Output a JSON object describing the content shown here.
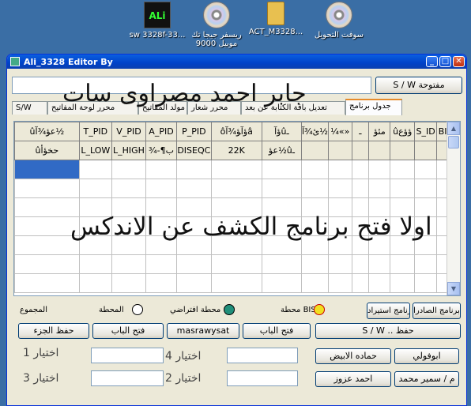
{
  "desktop": {
    "icons": [
      {
        "label": "sw 3328f-33...",
        "kind": "ali-icon",
        "text": "ALi"
      },
      {
        "label": "ريسفر جيجا تك موبيل 9000",
        "kind": "cd-icon"
      },
      {
        "label": "ACT_M3328...",
        "kind": "folder-icon"
      },
      {
        "label": "سوفت التحويل",
        "kind": "cd-icon"
      }
    ]
  },
  "window": {
    "title": "Ali_3328 Editor By",
    "controls": {
      "minimize": "_",
      "maximize": "□",
      "close": "✕"
    }
  },
  "top": {
    "textbox_value": "",
    "key_button": "S / W مفتوحة"
  },
  "overlay": {
    "name": "جابر احمد مصراوى سات",
    "instruction": "اولا فتح برنامج الكشف عن الاندكس"
  },
  "tabs": [
    {
      "label": "جدول برنامج",
      "active": true
    },
    {
      "label": "تعديل باقة الكتابة عن بعد",
      "active": false
    },
    {
      "label": "محرر شعار",
      "active": false
    },
    {
      "label": "مولد المفاتيح",
      "active": false
    },
    {
      "label": "محرر لوحة المفاتيح",
      "active": false
    },
    {
      "label": "S/W",
      "active": false
    }
  ],
  "grid": {
    "headers": [
      "ûعؤ¾آ½",
      "T_PID",
      "V_PID",
      "A_PID",
      "P_PID",
      "ôآ‍ؤ¾آ‎ؤâ",
      "ؤآûـ",
      "ئ¾آ½",
      "¼«»",
      "ـ",
      "مئؤ",
      "ûؤؤع",
      "S_ID",
      "BISS"
    ],
    "row2": [
      "ûحخؤأ",
      "L_LOW",
      "L_HIGH",
      "¾-¶ب",
      "DISEQC",
      "22K",
      "عؤ½ûـ",
      "",
      "",
      "",
      "",
      "",
      "",
      ""
    ]
  },
  "status": {
    "items": [
      "المجموع",
      "المحطة",
      "محطة افتراضي",
      "محطة BISS"
    ],
    "colors": {
      "circle_white": "#ffffff",
      "circle_green": "#1f8f7a",
      "circle_yellow": "#f0e020"
    }
  },
  "buttons": {
    "save_part": "حفظ الجزء",
    "open_door1": "فتح الباب",
    "masrawysat": "masrawysat",
    "open_door2": "فتح الباب",
    "save_sw": "S / W .. حفظ",
    "import_prog": "برنامج استيراد",
    "export_prog": "برنامج الصادرا",
    "ibofooli": "ابوفولي",
    "hamada": "حماده الابيض",
    "ahmed": "احمد عزوز",
    "samir": "م / سمير محمد"
  },
  "choices": {
    "c1": "اختيار 1",
    "c2": "اختيار 2",
    "c3": "اختيار 3",
    "c4": "اختيار 4"
  }
}
